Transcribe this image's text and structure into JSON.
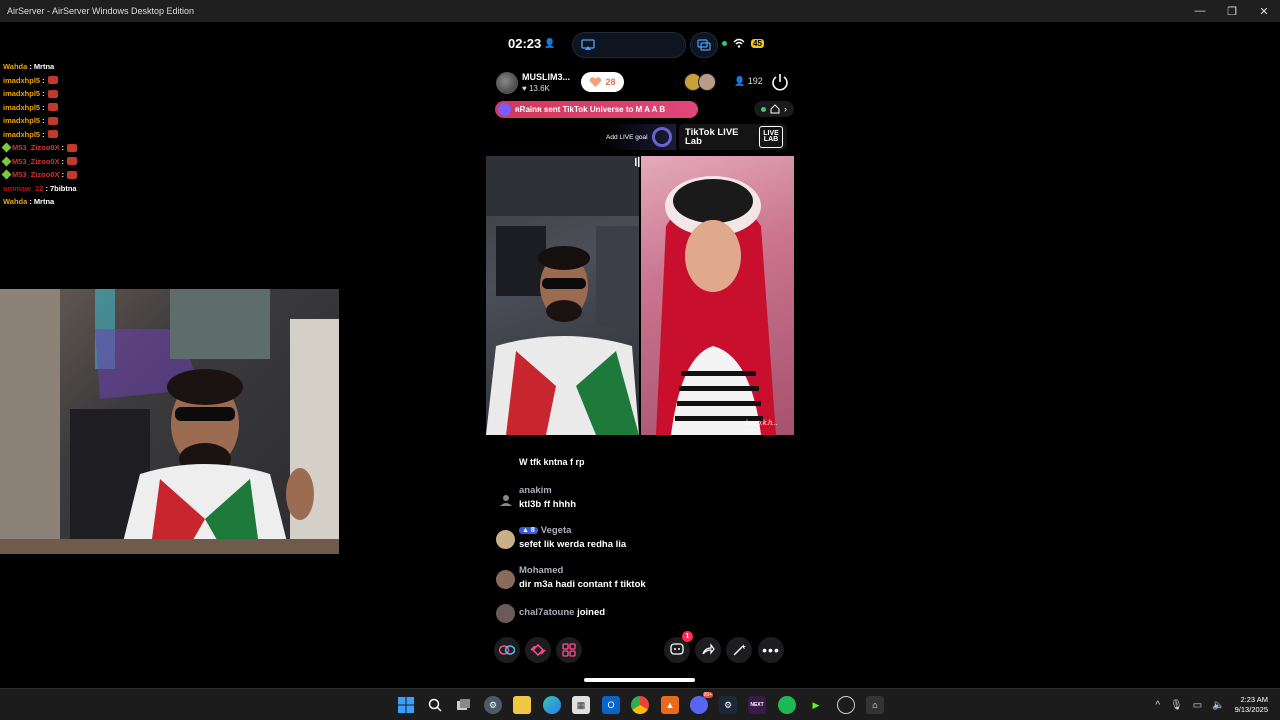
{
  "window": {
    "title": "AirServer - AirServer Windows Desktop Edition",
    "minimize": "—",
    "maximize": "❐",
    "close": "✕"
  },
  "overlay_chat": [
    {
      "user": "Wahda",
      "color": "#f0a500",
      "msg": "Mrtna",
      "emote": false,
      "badge": false
    },
    {
      "user": "imadxhpl5",
      "color": "#f0a500",
      "msg": "",
      "emote": true,
      "badge": false
    },
    {
      "user": "imadxhpl5",
      "color": "#f0a500",
      "msg": "",
      "emote": true,
      "badge": false
    },
    {
      "user": "imadxhpl5",
      "color": "#f0a500",
      "msg": "",
      "emote": true,
      "badge": false
    },
    {
      "user": "imadxhpl5",
      "color": "#f0a500",
      "msg": "",
      "emote": true,
      "badge": false
    },
    {
      "user": "imadxhpl5",
      "color": "#f0a500",
      "msg": "",
      "emote": true,
      "badge": false
    },
    {
      "user": "M53_Zizoo0X",
      "color": "#d63031",
      "msg": "",
      "emote": true,
      "badge": true
    },
    {
      "user": "M53_Zizoo0X",
      "color": "#d63031",
      "msg": "",
      "emote": true,
      "badge": true
    },
    {
      "user": "M53_Zizoo0X",
      "color": "#d63031",
      "msg": "",
      "emote": true,
      "badge": true
    },
    {
      "user": "ommaw_22",
      "color": "#b8131f",
      "msg": "7bibtna",
      "emote": false,
      "badge": false
    },
    {
      "user": "Wahda",
      "color": "#f0a500",
      "msg": "Mrtna",
      "emote": false,
      "badge": false
    }
  ],
  "phone": {
    "time": "02:23",
    "battery": "45",
    "host": {
      "name": "MUSLIM3...",
      "likes": "13.6K"
    },
    "follow_count": "28",
    "viewer_count": "192",
    "gift_banner": "ʀRainʀ sent TikTok Universe to M A A B",
    "add_goal": "Add LIVE goal",
    "lab_title": "TikTok LIVE Lab",
    "lab_logo": "LIVE LAB",
    "guest_tag": "k.n.o.k.h...",
    "chat": {
      "cut_line": "W tfk kntna f rp",
      "messages": [
        {
          "user": "anakim",
          "text": "ktl3b ff hhhh",
          "level": "",
          "avatar": "#4a4a4a"
        },
        {
          "user": "Vegeta",
          "text": "sefet lik werda redha lia",
          "level": "8",
          "avatar": "#c9b08a"
        },
        {
          "user": "Mohamed",
          "text": "dir m3a hadi contant f tiktok",
          "level": "",
          "avatar": "#8a6a5a"
        }
      ],
      "joined": {
        "user": "chal7atoune",
        "word": "joined"
      }
    },
    "notification_count": "1"
  },
  "taskbar": {
    "time": "2:23 AM",
    "date": "9/13/2025",
    "discord_badge": "99+",
    "next_label": "NEXT"
  },
  "colors": {
    "accent_pink": "#fe2c55",
    "gift_banner": "#d2385a"
  }
}
